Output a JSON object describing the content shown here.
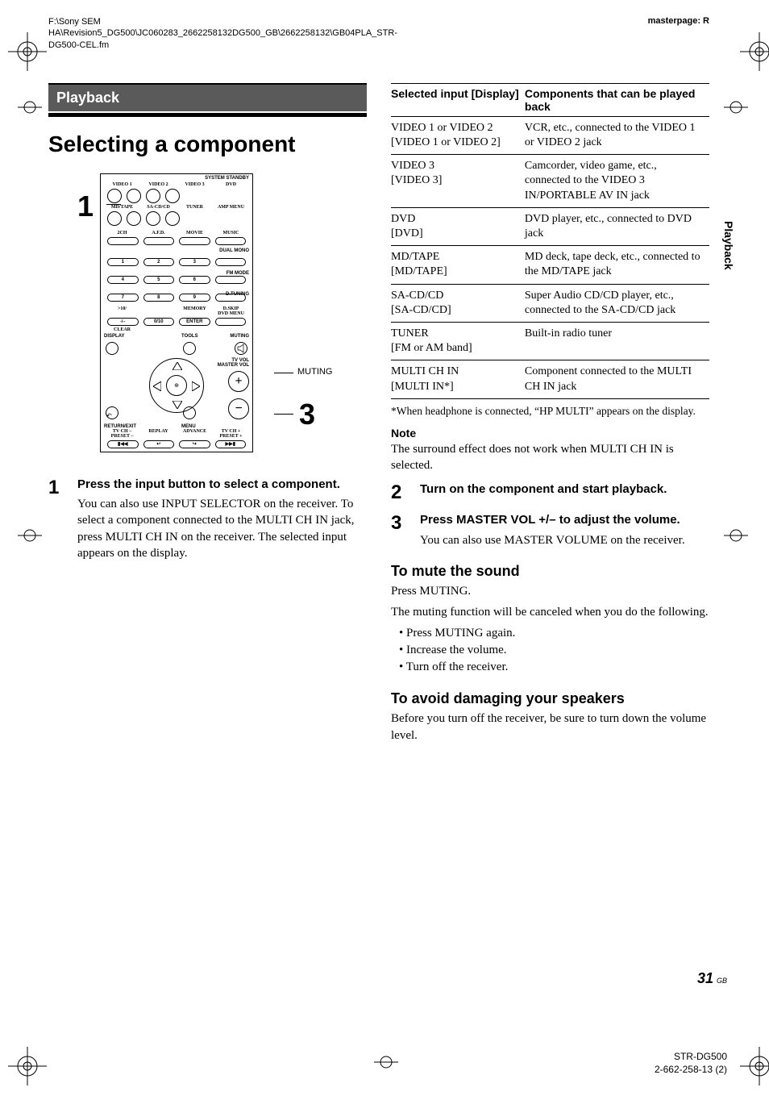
{
  "header": {
    "file_path": "F:\\Sony SEM HA\\Revision5_DG500\\JC060283_2662258132DG500_GB\\2662258132\\GB04PLA_STR-DG500-CEL.fm",
    "masterpage": "masterpage: R"
  },
  "section_tag": "Playback",
  "title": "Selecting a component",
  "side_tab": "Playback",
  "remote": {
    "callout_1": "1",
    "callout_3": "3",
    "callout_muting": "MUTING",
    "rows": {
      "system_standby": "SYSTEM STANDBY",
      "r1_labels": [
        "VIDEO 1",
        "VIDEO 2",
        "VIDEO 3",
        "DVD"
      ],
      "r2_labels": [
        "MD/TAPE",
        "SA-CD/CD",
        "TUNER",
        "AMP MENU"
      ],
      "r3_labels": [
        "2CH",
        "A.F.D.",
        "MOVIE",
        "MUSIC"
      ],
      "dual_mono": "DUAL MONO",
      "nums_row1": [
        "1",
        "2",
        "3"
      ],
      "nums_row2": [
        "4",
        "5",
        "6"
      ],
      "nums_row3": [
        "7",
        "8",
        "9"
      ],
      "fm_mode": "FM MODE",
      "d_tuning": "D.TUNING",
      "d_skip": "D.SKIP",
      "memory": "MEMORY",
      "dvd_menu": "DVD MENU",
      "ten_plus": ">10/",
      "clear": "CLEAR",
      "zero_ten": "0/10",
      "enter": "ENTER",
      "display": "DISPLAY",
      "tools": "TOOLS",
      "muting": "MUTING",
      "tv_vol": "TV VOL",
      "master_vol": "MASTER VOL",
      "return_exit": "RETURN/EXIT",
      "menu": "MENU",
      "tv_ch_minus": "TV CH –",
      "preset_minus": "PRESET –",
      "replay": "REPLAY",
      "advance": "ADVANCE",
      "tv_ch_plus": "TV CH +",
      "preset_plus": "PRESET +"
    }
  },
  "steps": {
    "s1": {
      "num": "1",
      "head": "Press the input button to select a component.",
      "body": "You can also use INPUT SELECTOR on the receiver. To select a component connected to the MULTI CH IN jack, press MULTI CH IN on the receiver. The selected input appears on the display."
    },
    "s2": {
      "num": "2",
      "head": "Turn on the component and start playback."
    },
    "s3": {
      "num": "3",
      "head": "Press MASTER VOL +/– to adjust the volume.",
      "body": "You can also use MASTER VOLUME on the receiver."
    }
  },
  "table": {
    "th1": "Selected input [Display]",
    "th2": "Components that can be played back",
    "rows": [
      {
        "c1": "VIDEO 1 or VIDEO 2\n[VIDEO 1 or VIDEO 2]",
        "c2": "VCR, etc., connected to the VIDEO 1 or VIDEO 2 jack"
      },
      {
        "c1": "VIDEO 3\n[VIDEO 3]",
        "c2": "Camcorder, video game, etc., connected to the VIDEO 3 IN/PORTABLE AV IN jack"
      },
      {
        "c1": "DVD\n[DVD]",
        "c2": "DVD player, etc., connected to DVD jack"
      },
      {
        "c1": "MD/TAPE\n[MD/TAPE]",
        "c2": "MD deck, tape deck, etc., connected to the MD/TAPE jack"
      },
      {
        "c1": "SA-CD/CD\n[SA-CD/CD]",
        "c2": "Super Audio CD/CD player, etc., connected to the SA-CD/CD jack"
      },
      {
        "c1": "TUNER\n[FM or AM band]",
        "c2": "Built-in radio tuner"
      },
      {
        "c1": "MULTI CH IN\n[MULTI IN*]",
        "c2": "Component connected to the MULTI CH IN jack"
      }
    ]
  },
  "footnote": "*When headphone is connected, “HP MULTI” appears on the display.",
  "note": {
    "label": "Note",
    "text": "The surround effect does not work when MULTI CH IN is selected."
  },
  "mute": {
    "heading": "To mute the sound",
    "p1": "Press MUTING.",
    "p2": "The muting function will be canceled when you do the following.",
    "bullets": [
      "Press MUTING again.",
      "Increase the volume.",
      "Turn off the receiver."
    ]
  },
  "avoid": {
    "heading": "To avoid damaging your speakers",
    "body": "Before you turn off the receiver, be sure to turn down the volume level."
  },
  "page_number": "31",
  "page_lang": "GB",
  "model_block": "STR-DG500\n2-662-258-13 (2)"
}
